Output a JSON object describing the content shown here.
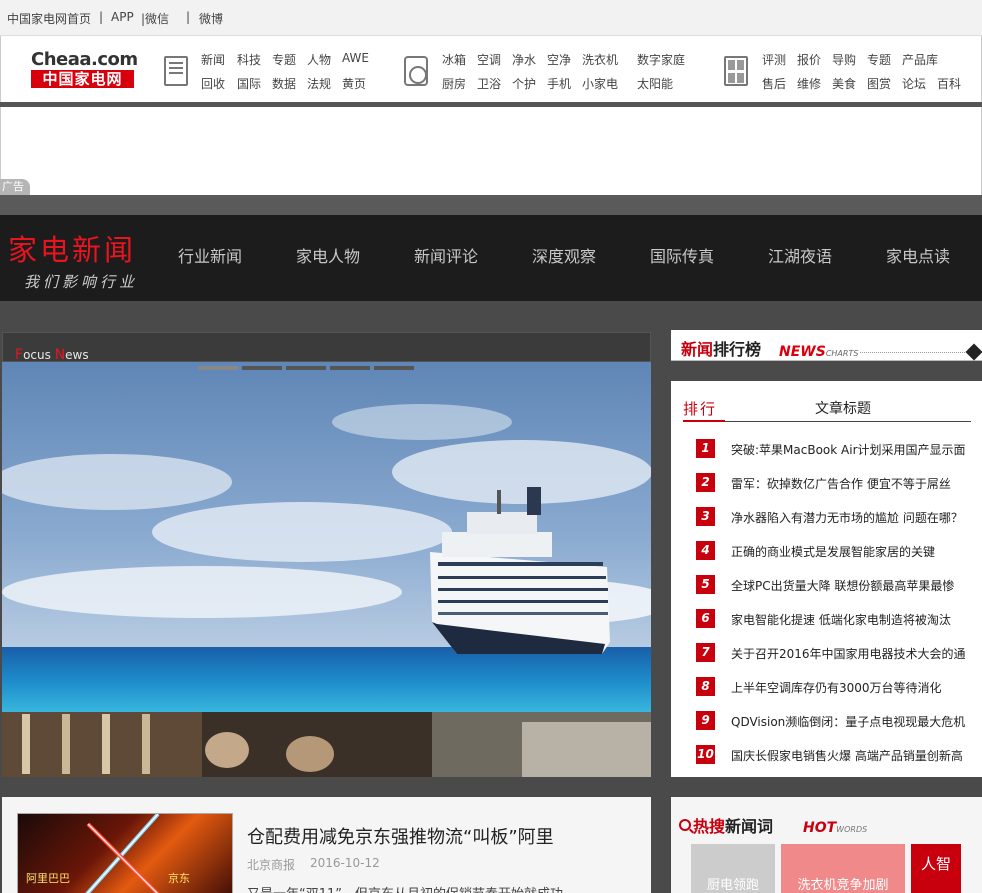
{
  "topbar": {
    "home": "中国家电网首页",
    "sep1": "|",
    "app": "APP",
    "wechat": "|微信",
    "sep2": "|",
    "weibo": "微博"
  },
  "logo": {
    "en": "Cheaa.com",
    "cn": "中国家电网"
  },
  "nav": {
    "group1": [
      "新闻",
      "科技",
      "专题",
      "人物",
      "AWE",
      "回收",
      "国际",
      "数据",
      "法规",
      "黄页"
    ],
    "group2": [
      "冰箱",
      "空调",
      "净水",
      "空净",
      "洗衣机",
      "数字家庭",
      "厨房",
      "卫浴",
      "个护",
      "手机",
      "小家电",
      "太阳能"
    ],
    "group3": [
      "评测",
      "报价",
      "导购",
      "专题",
      "产品库",
      "售后",
      "维修",
      "美食",
      "图赏",
      "论坛",
      "百科"
    ]
  },
  "ad": {
    "label": "广告"
  },
  "channel": {
    "title": "家电新闻",
    "slogan": "我们影响行业",
    "items": [
      "行业新闻",
      "家电人物",
      "新闻评论",
      "深度观察",
      "国际传真",
      "江湖夜语",
      "家电点读"
    ]
  },
  "focus": {
    "first1": "F",
    "rest1": "ocus ",
    "first2": "N",
    "rest2": "ews"
  },
  "rank": {
    "title_red": "新闻",
    "title_black": "排行榜",
    "en": "NEWS",
    "en_small": "CHARTS",
    "col_rank": "排行",
    "col_title": "文章标题",
    "items": [
      {
        "num": "1",
        "title": "突破:苹果MacBook Air计划采用国产显示面"
      },
      {
        "num": "2",
        "title": "雷军：砍掉数亿广告合作 便宜不等于屌丝"
      },
      {
        "num": "3",
        "title": "净水器陷入有潜力无市场的尴尬 问题在哪？"
      },
      {
        "num": "4",
        "title": "正确的商业模式是发展智能家居的关键"
      },
      {
        "num": "5",
        "title": "全球PC出货量大降 联想份额最高苹果最惨"
      },
      {
        "num": "6",
        "title": "家电智能化提速 低端化家电制造将被淘汰"
      },
      {
        "num": "7",
        "title": "关于召开2016年中国家用电器技术大会的通"
      },
      {
        "num": "8",
        "title": "上半年空调库存仍有3000万台等待消化"
      },
      {
        "num": "9",
        "title": "QDVision濒临倒闭：量子点电视现最大危机"
      },
      {
        "num": "10",
        "title": "国庆长假家电销售火爆 高端产品销量创新高"
      }
    ]
  },
  "article": {
    "title": "仓配费用减免京东强推物流“叫板”阿里",
    "source": "北京商报",
    "date": "2016-10-12",
    "summary": "又是一年“双11”，但京东从月初的促销节奏开始就成功",
    "thumb_label1": "阿里巴巴",
    "thumb_label2": "京东"
  },
  "hot": {
    "title_red": "热搜",
    "title_black": "新闻词",
    "en": "HOT",
    "en_small": "WORDS",
    "keywords": [
      {
        "label": "厨电领跑",
        "color": "#cccccc"
      },
      {
        "label": "洗衣机竞争加剧",
        "color": "#f08a8a"
      },
      {
        "label": "人智",
        "color": "#c8000e"
      }
    ]
  },
  "colors": {
    "accent": "#c8000e",
    "channel_bg": "#1c1c1c",
    "page_bg": "#4a4a4a"
  }
}
